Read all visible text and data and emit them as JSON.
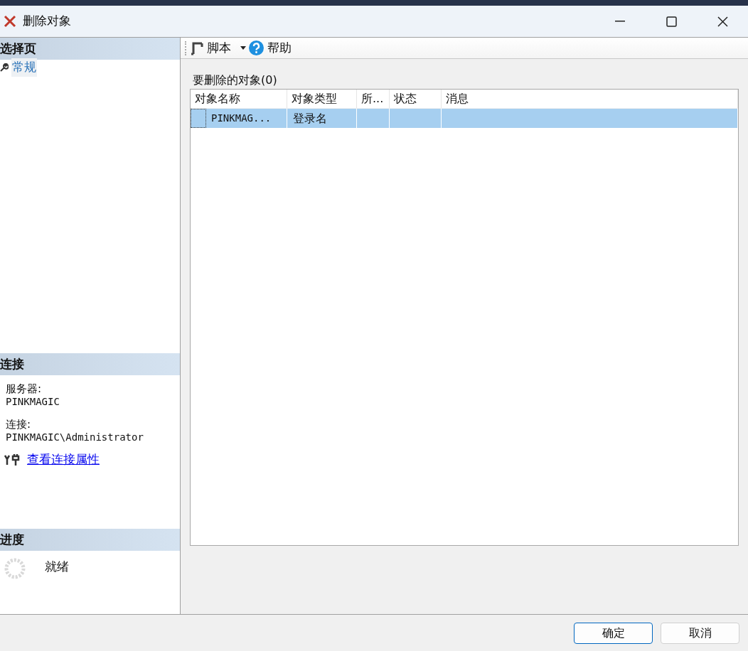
{
  "window": {
    "title": "删除对象"
  },
  "sidebar": {
    "select_page": {
      "header": "选择页",
      "items": [
        {
          "label": "常规",
          "selected": true
        }
      ]
    },
    "connection": {
      "header": "连接",
      "server_label": "服务器:",
      "server": "PINKMAGIC",
      "connection_label": "连接:",
      "connection": "PINKMAGIC\\Administrator",
      "link": "查看连接属性"
    },
    "progress": {
      "header": "进度",
      "status": "就绪"
    }
  },
  "toolbar": {
    "script": "脚本",
    "help": "帮助"
  },
  "objects": {
    "label": "要删除的对象(0)",
    "columns": [
      "对象名称",
      "对象类型",
      "所...",
      "状态",
      "消息"
    ],
    "rows": [
      {
        "cells": [
          "PINKMAG...",
          "登录名",
          "",
          "",
          ""
        ],
        "selected": true
      }
    ]
  },
  "buttons": [
    {
      "label": "确定",
      "default": true
    },
    {
      "label": "取消",
      "default": false
    }
  ]
}
